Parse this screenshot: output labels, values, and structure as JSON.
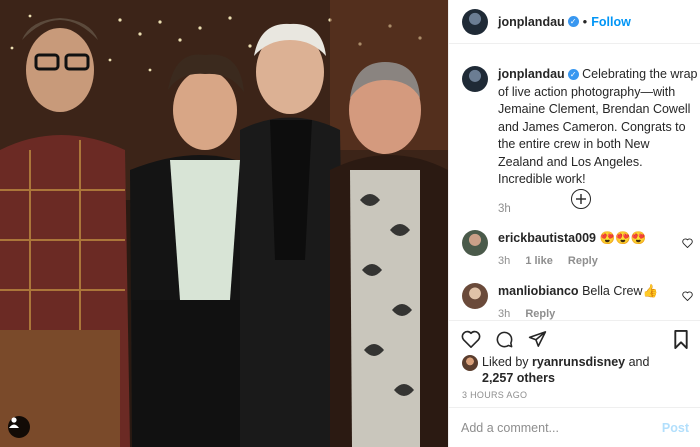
{
  "post": {
    "author": "jonplandau",
    "follow_label": "Follow",
    "dot": "•",
    "caption_user": "jonplandau",
    "caption_text": "Celebrating the wrap of live action photography—with Jemaine Clement, Brendan Cowell and James Cameron.  Congrats to the entire crew in both New Zealand and Los Angeles. Incredible work!",
    "caption_time": "3h",
    "verified_glyph": "✓"
  },
  "comments": [
    {
      "user": "erickbautista009",
      "text": "😍😍😍",
      "time": "3h",
      "likes": "1 like",
      "reply": "Reply"
    },
    {
      "user": "manliobianco",
      "text": "Bella Crew👍",
      "time": "3h",
      "reply": "Reply"
    }
  ],
  "likes": {
    "prefix": "Liked by ",
    "user": "ryanrunsdisney",
    "joiner": " and",
    "others": "2,257 others"
  },
  "timestamp": "3 HOURS AGO",
  "add_comment": {
    "placeholder": "Add a comment...",
    "post_label": "Post"
  },
  "icons": {
    "heart": "heart-icon",
    "comment": "comment-icon",
    "share": "share-icon",
    "bookmark": "bookmark-icon",
    "more": "add-more-icon",
    "tag": "user-tag-icon"
  },
  "colors": {
    "link": "#0095f6",
    "verified": "#3897f0",
    "muted": "#8e8e8e",
    "post_disabled": "#b2dffc"
  }
}
